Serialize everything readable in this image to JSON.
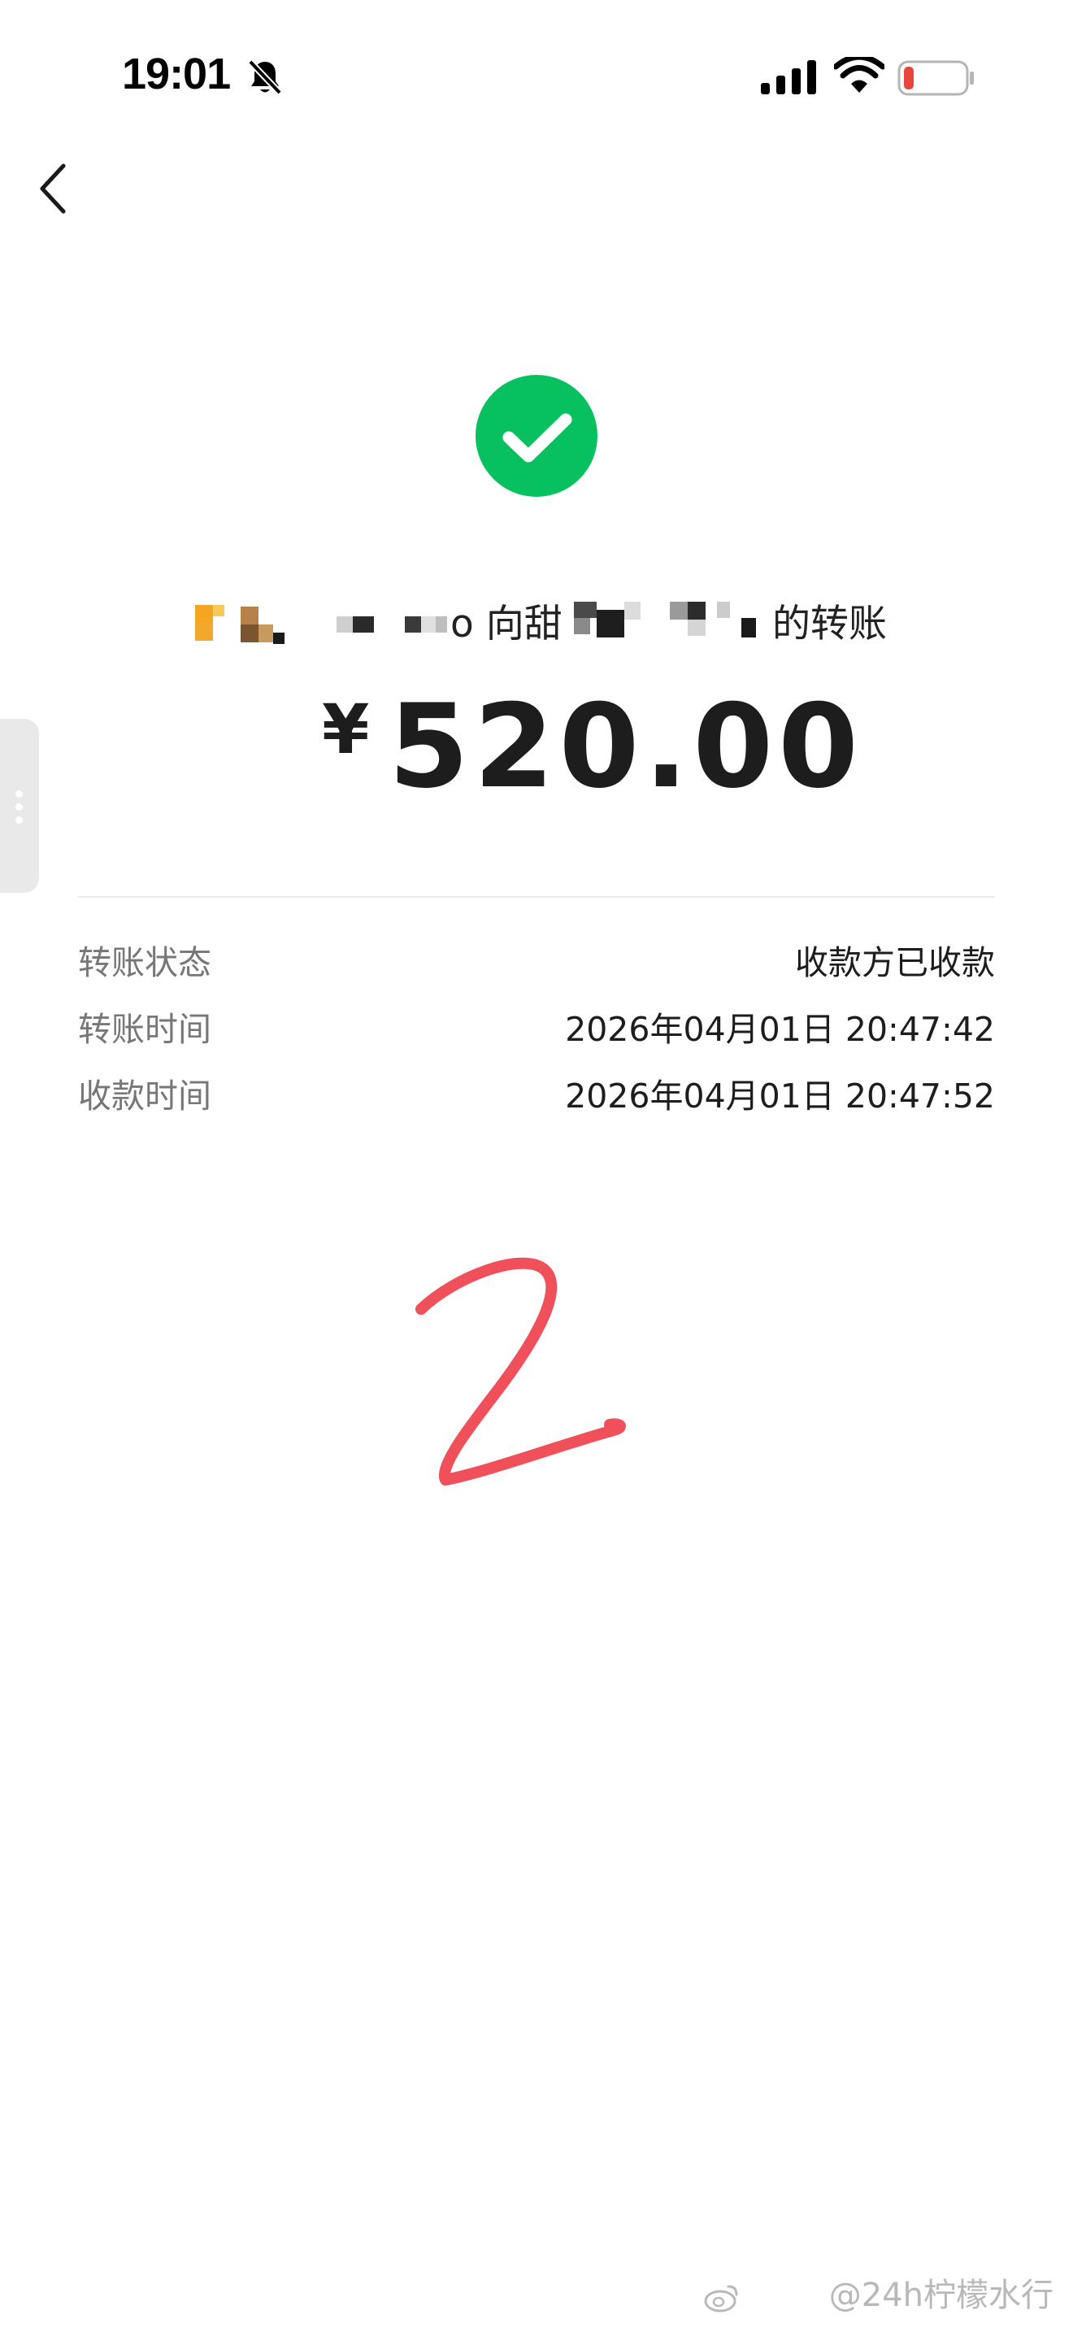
{
  "status_bar": {
    "time": "19:01",
    "icons": [
      "bell-muted-icon",
      "signal-icon",
      "wifi-icon",
      "battery-low-icon"
    ]
  },
  "nav": {
    "back_icon": "chevron-left-icon"
  },
  "success_icon": "check-circle-icon",
  "transfer": {
    "title_fragment_1": "o 向甜",
    "title_fragment_2": "的转账",
    "currency_symbol": "¥",
    "amount": "520.00"
  },
  "details": [
    {
      "label": "转账状态",
      "value": "收款方已收款"
    },
    {
      "label": "转账时间",
      "value": "2026年04月01日 20:47:42"
    },
    {
      "label": "收款时间",
      "value": "2026年04月01日 20:47:52"
    }
  ],
  "annotation": {
    "handwritten": "2"
  },
  "watermark": "@24h柠檬水行",
  "colors": {
    "success_green": "#07C160",
    "handwriting_red": "#F0505A",
    "battery_red": "#E8453C",
    "label_gray": "#777777"
  }
}
